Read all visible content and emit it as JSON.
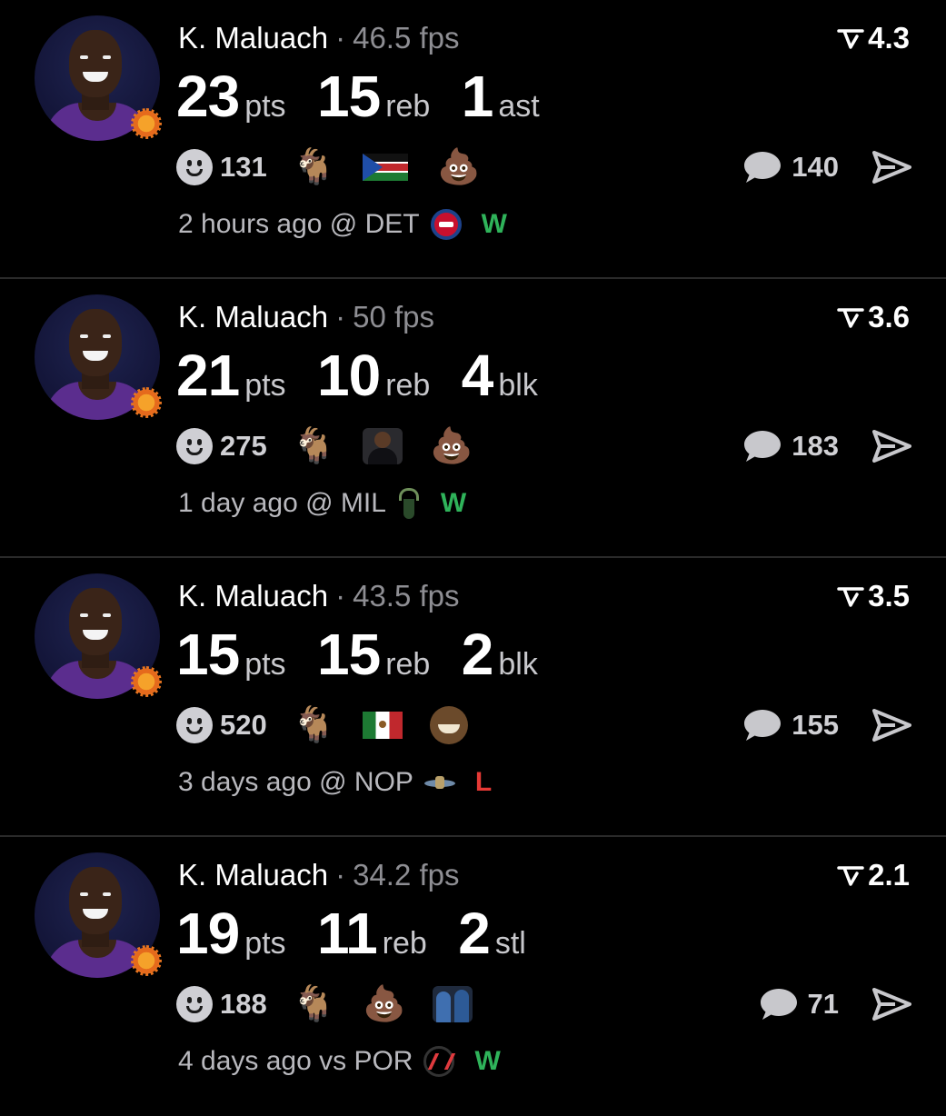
{
  "colors": {
    "win": "#2fb35a",
    "loss": "#e53935",
    "muted": "#8e8e93",
    "background": "#000000"
  },
  "icons": {
    "rating": "rating-chevron-icon",
    "reaction": "smiley-icon",
    "comment": "speech-bubble-icon",
    "share": "paper-plane-icon"
  },
  "cards": [
    {
      "player_name": "K. Maluach",
      "separator": "·",
      "fps": "46.5 fps",
      "rating": "4.3",
      "stats": [
        {
          "value": "23",
          "unit": "pts"
        },
        {
          "value": "15",
          "unit": "reb"
        },
        {
          "value": "1",
          "unit": "ast"
        }
      ],
      "reaction_count": "131",
      "reactions": [
        "goat",
        "south-sudan-flag",
        "poop"
      ],
      "emoji": {
        "goat": "🐐",
        "poop": "💩"
      },
      "comment_count": "140",
      "time_ago": "2 hours ago @ DET",
      "opponent_logo": "pistons-logo",
      "result": "W"
    },
    {
      "player_name": "K. Maluach",
      "separator": "·",
      "fps": "50 fps",
      "rating": "3.6",
      "stats": [
        {
          "value": "21",
          "unit": "pts"
        },
        {
          "value": "10",
          "unit": "reb"
        },
        {
          "value": "4",
          "unit": "blk"
        }
      ],
      "reaction_count": "275",
      "reactions": [
        "goat",
        "coach-photo",
        "poop"
      ],
      "emoji": {
        "goat": "🐐",
        "poop": "💩"
      },
      "comment_count": "183",
      "time_ago": "1 day ago @ MIL",
      "opponent_logo": "bucks-logo",
      "result": "W"
    },
    {
      "player_name": "K. Maluach",
      "separator": "·",
      "fps": "43.5 fps",
      "rating": "3.5",
      "stats": [
        {
          "value": "15",
          "unit": "pts"
        },
        {
          "value": "15",
          "unit": "reb"
        },
        {
          "value": "2",
          "unit": "blk"
        }
      ],
      "reaction_count": "520",
      "reactions": [
        "goat",
        "mexico-flag",
        "laughing-man"
      ],
      "emoji": {
        "goat": "🐐"
      },
      "comment_count": "155",
      "time_ago": "3 days ago @ NOP",
      "opponent_logo": "pelicans-logo",
      "result": "L"
    },
    {
      "player_name": "K. Maluach",
      "separator": "·",
      "fps": "34.2 fps",
      "rating": "2.1",
      "stats": [
        {
          "value": "19",
          "unit": "pts"
        },
        {
          "value": "11",
          "unit": "reb"
        },
        {
          "value": "2",
          "unit": "stl"
        }
      ],
      "reaction_count": "188",
      "reactions": [
        "goat",
        "poop",
        "team-photo"
      ],
      "emoji": {
        "goat": "🐐",
        "poop": "💩"
      },
      "comment_count": "71",
      "time_ago": "4 days ago vs POR",
      "opponent_logo": "trail-blazers-logo",
      "result": "W"
    }
  ]
}
